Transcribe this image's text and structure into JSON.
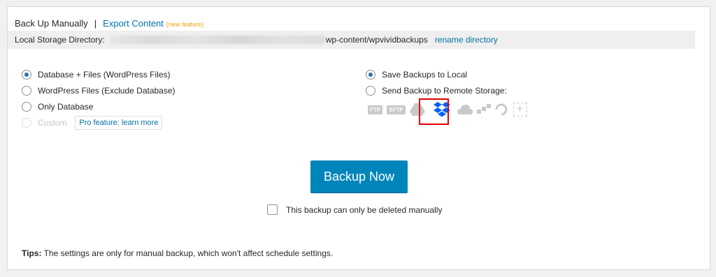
{
  "header": {
    "active_tab": "Back Up Manually",
    "separator": "|",
    "export_tab": "Export Content",
    "new_feature": "(new feature)"
  },
  "storage": {
    "label": "Local Storage Directory:",
    "path_tail": "wp-content/wpvividbackups",
    "rename_link": "rename directory"
  },
  "content_options": [
    {
      "label": "Database + Files (WordPress Files)",
      "checked": true
    },
    {
      "label": "WordPress Files (Exclude Database)",
      "checked": false
    },
    {
      "label": "Only Database",
      "checked": false
    },
    {
      "label": "Custom",
      "checked": false,
      "disabled": true
    }
  ],
  "pro_feature": "Pro feature: learn more",
  "destination_options": [
    {
      "label": "Save Backups to Local",
      "checked": true
    },
    {
      "label": "Send Backup to Remote Storage:",
      "checked": false
    }
  ],
  "remote_icons": [
    {
      "name": "ftp-icon",
      "text": "FTP"
    },
    {
      "name": "sftp-icon",
      "text": "SFTP"
    },
    {
      "name": "google-drive-icon"
    },
    {
      "name": "dropbox-icon",
      "color": "#0061ff",
      "highlighted": true
    },
    {
      "name": "onedrive-icon"
    },
    {
      "name": "amazon-s3-icon"
    },
    {
      "name": "digitalocean-icon"
    },
    {
      "name": "add-remote-icon",
      "text": "+"
    }
  ],
  "backup_button": "Backup Now",
  "manual_delete": "This backup can only be deleted manually",
  "tips": {
    "label": "Tips:",
    "text": " The settings are only for manual backup, which won't affect schedule settings."
  },
  "colors": {
    "link": "#0073aa",
    "primary_button": "#0085ba",
    "highlight": "#e00000",
    "new_feature": "#f0a30a"
  }
}
